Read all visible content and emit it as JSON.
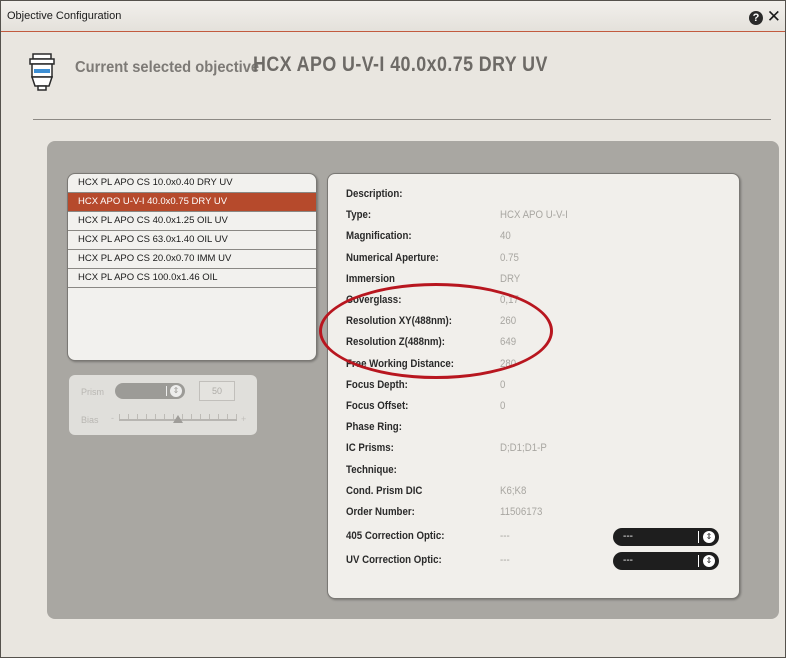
{
  "window": {
    "title": "Objective Configuration",
    "help_icon": "help-icon",
    "close_icon": "close-icon",
    "help_glyph": "?",
    "close_glyph": "✕"
  },
  "header": {
    "label": "Current selected objective",
    "value": "HCX APO U-V-I  40.0x0.75 DRY  UV",
    "icon": "objective-icon"
  },
  "objectives": [
    {
      "label": "HCX PL APO CS  10.0x0.40 DRY  UV",
      "selected": false
    },
    {
      "label": "HCX APO U-V-I  40.0x0.75 DRY  UV",
      "selected": true
    },
    {
      "label": "HCX PL APO CS  40.0x1.25 OIL  UV",
      "selected": false
    },
    {
      "label": "HCX PL APO CS  63.0x1.40 OIL  UV",
      "selected": false
    },
    {
      "label": "HCX PL APO CS  20.0x0.70 IMM  UV",
      "selected": false
    },
    {
      "label": "HCX PL APO CS 100.0x1.46 OIL",
      "selected": false
    }
  ],
  "prism": {
    "label": "Prism",
    "value": "50",
    "bias_label": "Bias",
    "minus": "-",
    "plus": "+",
    "arrows": "⇕"
  },
  "details": [
    {
      "label": "Description:",
      "value": ""
    },
    {
      "label": "Type:",
      "value": "HCX APO U-V-I"
    },
    {
      "label": "Magnification:",
      "value": "40"
    },
    {
      "label": "Numerical Aperture:",
      "value": "0.75"
    },
    {
      "label": "Immersion",
      "value": "DRY"
    },
    {
      "label": "Coverglass:",
      "value": "0,17"
    },
    {
      "label": "Resolution XY(488nm):",
      "value": "260"
    },
    {
      "label": "Resolution Z(488nm):",
      "value": "649"
    },
    {
      "label": "Free Working Distance:",
      "value": "280"
    },
    {
      "label": "Focus Depth:",
      "value": "0"
    },
    {
      "label": "Focus Offset:",
      "value": "0"
    },
    {
      "label": "Phase Ring:",
      "value": ""
    },
    {
      "label": "IC Prisms:",
      "value": "D;D1;D1-P"
    },
    {
      "label": "Technique:",
      "value": ""
    },
    {
      "label": "Cond. Prism DIC",
      "value": "K6;K8"
    },
    {
      "label": "Order Number:",
      "value": "11506173"
    }
  ],
  "corrections": [
    {
      "label": "405 Correction Optic:",
      "value": "---",
      "dropdown": "---"
    },
    {
      "label": "UV Correction Optic:",
      "value": "---",
      "dropdown": "---"
    }
  ],
  "dropdown_arrows": "⇕",
  "colors": {
    "selected_row": "#b64a2c",
    "annotation": "#b8161f",
    "panel": "#a9a7a2",
    "window_bg": "#e9e6e0"
  }
}
